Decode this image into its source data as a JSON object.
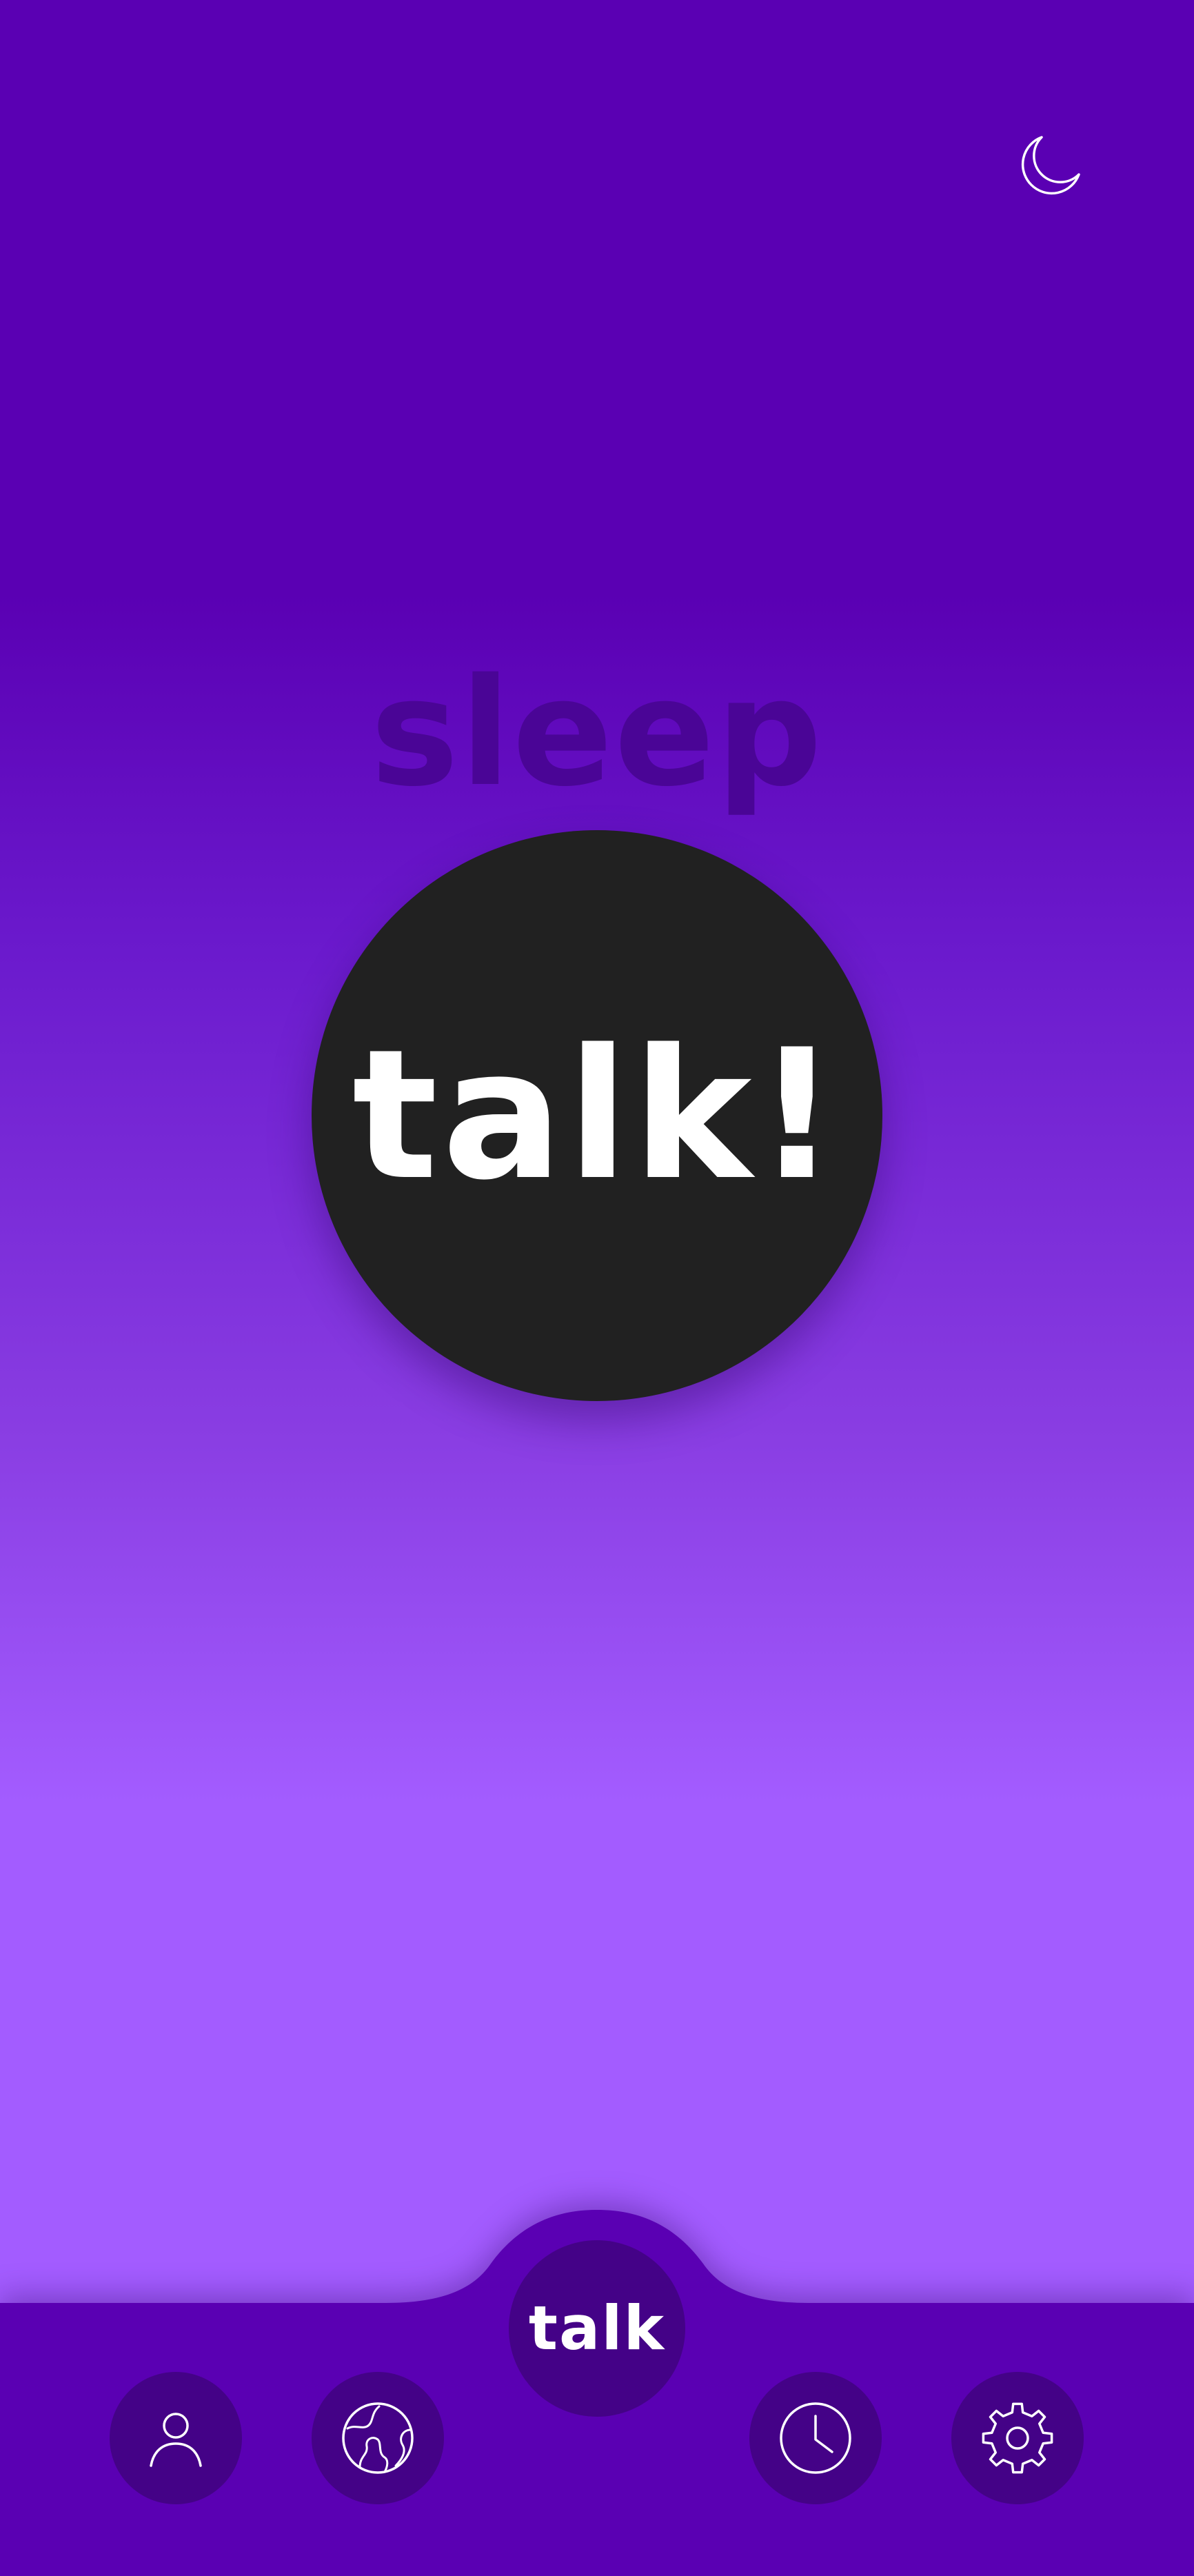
{
  "header": {
    "theme_toggle_icon": "moon-icon"
  },
  "main": {
    "mode_label": "sleep",
    "talk_button_label": "talk!"
  },
  "bottom_nav": {
    "center_button_label": "talk",
    "items": [
      {
        "icon": "person-icon"
      },
      {
        "icon": "globe-icon"
      },
      {
        "icon": "clock-icon"
      },
      {
        "icon": "gear-icon"
      }
    ]
  },
  "colors": {
    "background_top": "#5a00b3",
    "background_bottom": "#a35cff",
    "nav_bar": "#5a00b3",
    "nav_button": "#440287",
    "talk_circle": "#212121",
    "sleep_text": "#4a0596",
    "icon_stroke": "#ffffff"
  }
}
